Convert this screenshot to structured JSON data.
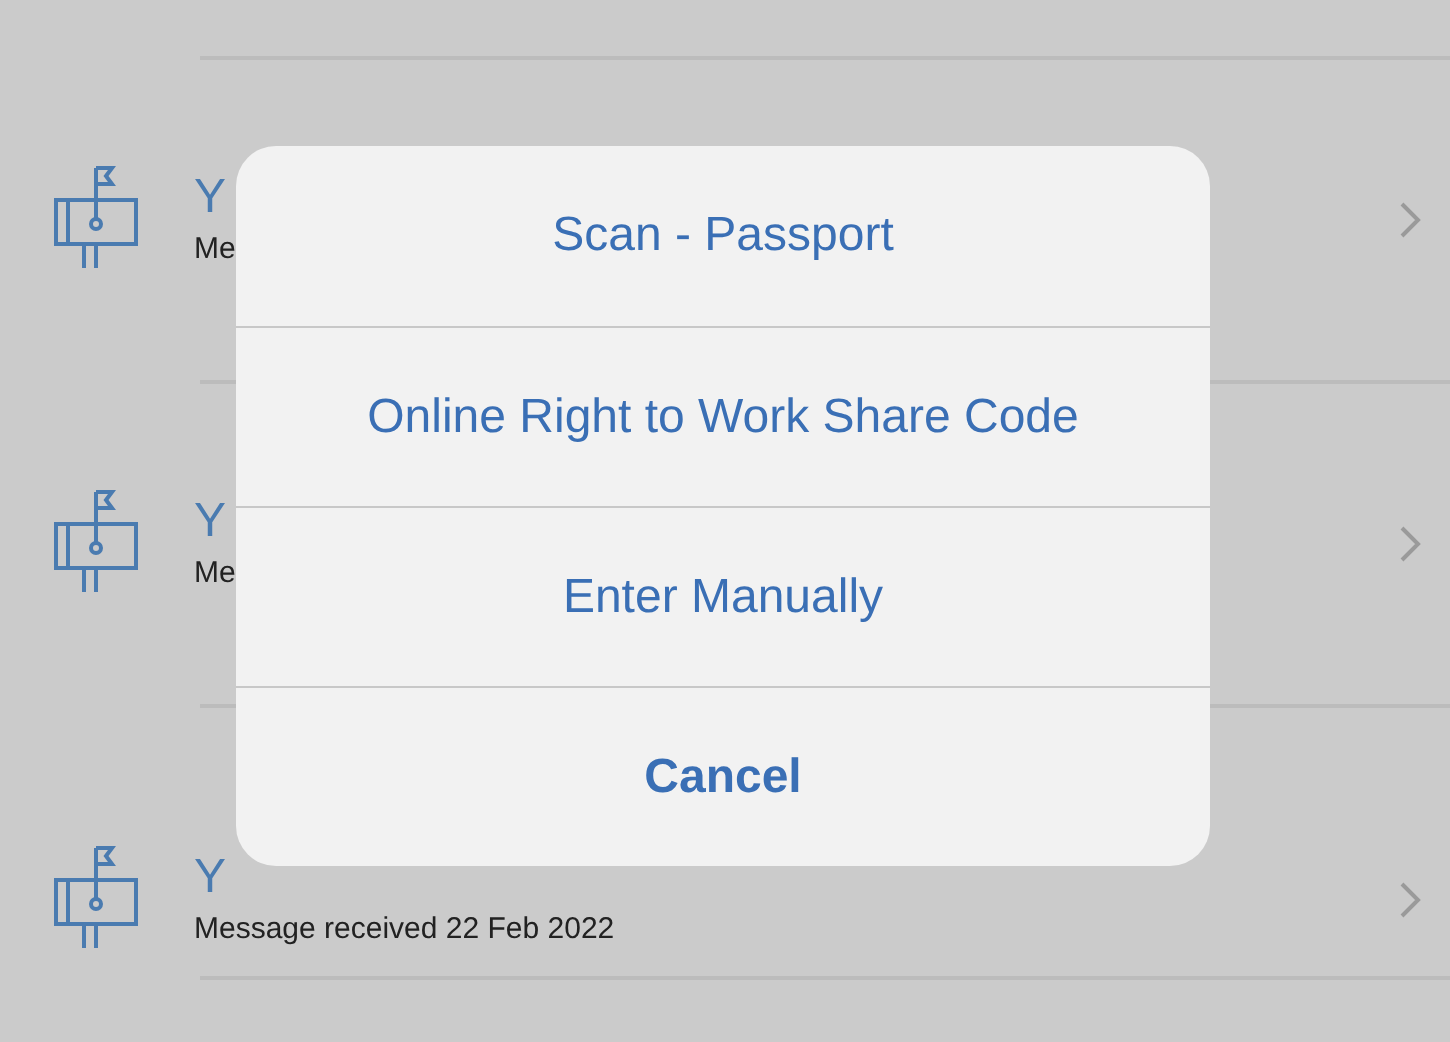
{
  "messages": [
    {
      "title": "Y",
      "subtitle": "Me"
    },
    {
      "title": "Y",
      "subtitle": "Me"
    },
    {
      "title": "Y",
      "subtitle": "Message received 22 Feb 2022"
    }
  ],
  "action_sheet": {
    "actions": [
      {
        "label": "Scan - Passport",
        "kind": "default"
      },
      {
        "label": "Online Right to Work Share Code",
        "kind": "default"
      },
      {
        "label": "Enter Manually",
        "kind": "default"
      },
      {
        "label": "Cancel",
        "kind": "cancel"
      }
    ]
  }
}
